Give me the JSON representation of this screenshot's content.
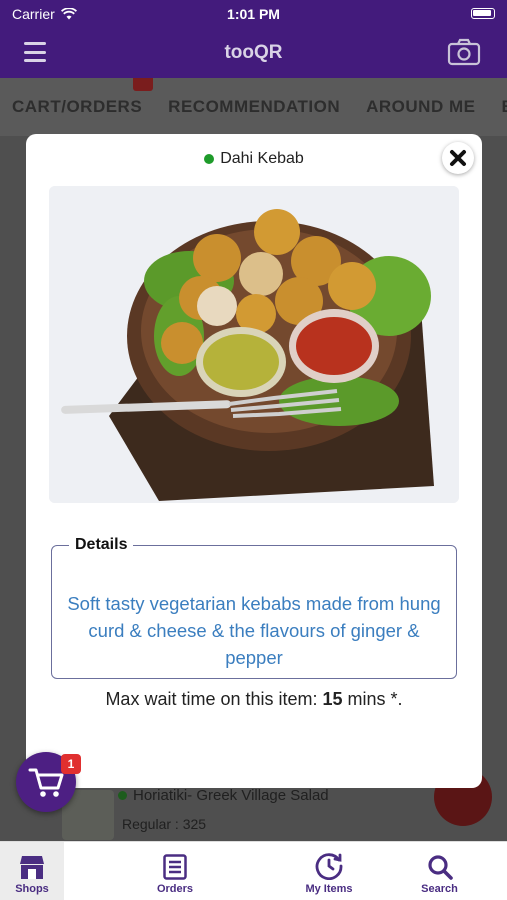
{
  "status_bar": {
    "carrier": "Carrier",
    "time": "1:01 PM"
  },
  "app_bar": {
    "title": "tooQR"
  },
  "tabs": [
    {
      "label": "CART/ORDERS"
    },
    {
      "label": "RECOMMENDATION"
    },
    {
      "label": "AROUND ME"
    },
    {
      "label": "BE"
    }
  ],
  "background_item": {
    "name": "Horiatiki- Greek Village Salad",
    "price": "Regular : 325"
  },
  "modal": {
    "item_name": "Dahi Kebab",
    "details_label": "Details",
    "description": "Soft tasty vegetarian kebabs made from hung curd & cheese & the flavours of ginger & pepper",
    "wait_prefix": "Max wait time on this item: ",
    "wait_value": "15",
    "wait_suffix": " mins *."
  },
  "cart": {
    "count": "1"
  },
  "bottom_nav": [
    {
      "label": "Shops",
      "icon": "store-icon"
    },
    {
      "label": "Orders",
      "icon": "list-icon"
    },
    {
      "label": "My Items",
      "icon": "clock-icon"
    },
    {
      "label": "Search",
      "icon": "search-icon"
    }
  ],
  "colors": {
    "brand": "#431b7c",
    "veg": "#1e9b2a",
    "link": "#3b7ebf",
    "badge": "#e02f2f"
  }
}
